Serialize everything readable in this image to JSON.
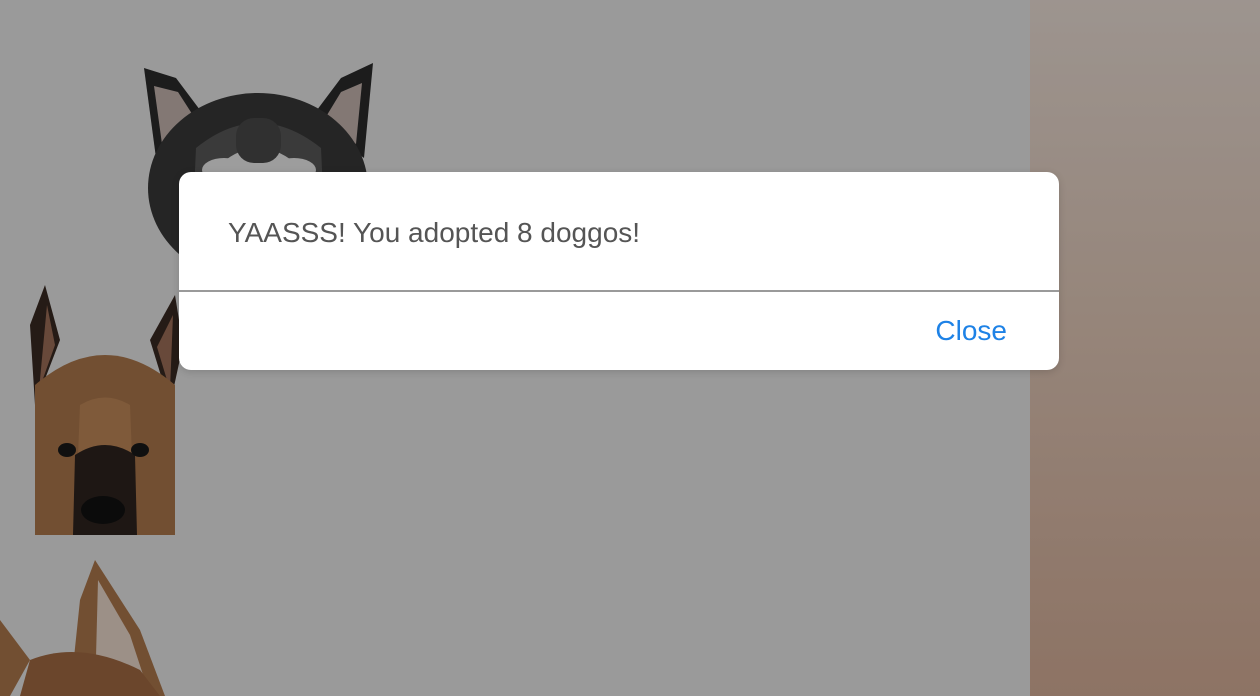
{
  "alert": {
    "message": "YAASSS! You adopted 8 doggos!",
    "close_label": "Close"
  },
  "dogs": [
    {
      "name": "husky-photo",
      "breed": "Husky"
    },
    {
      "name": "shepherd-photo",
      "breed": "German Shepherd"
    },
    {
      "name": "corgi-like-photo",
      "breed": "Shepherd mix"
    }
  ],
  "colors": {
    "accent": "#1e82e6",
    "message_text": "#555555",
    "overlay": "rgba(0,0,0,0.35)"
  }
}
